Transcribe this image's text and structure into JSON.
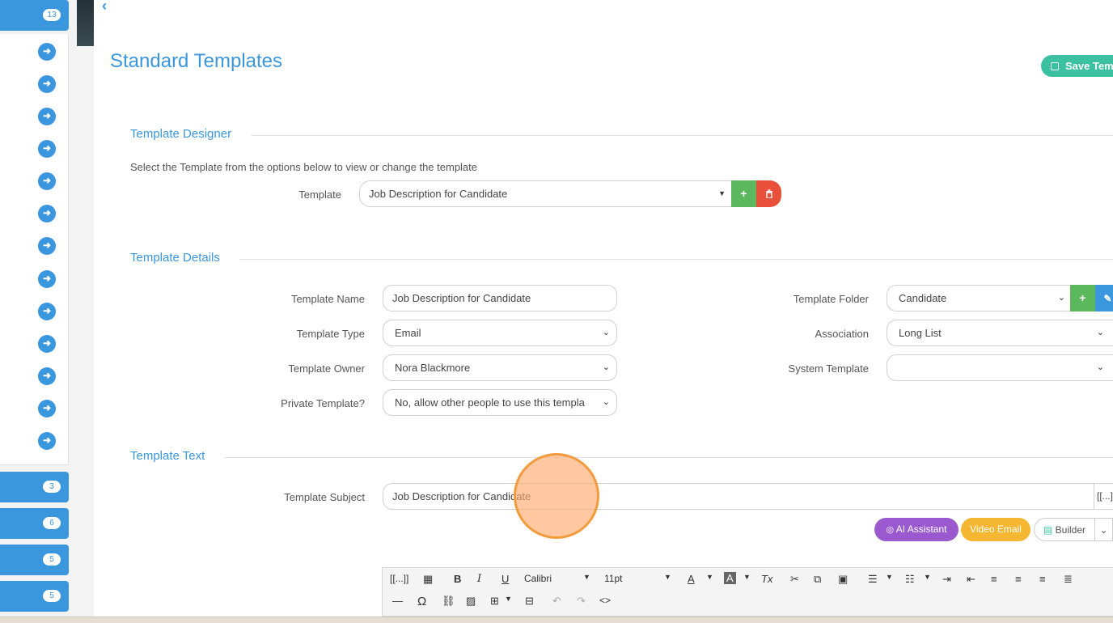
{
  "sidebar": {
    "top_badge": "13",
    "bottom_badges": [
      "3",
      "6",
      "5",
      "5"
    ],
    "arrow_icon": "arrow-right-icon"
  },
  "header": {
    "title": "Standard Templates",
    "save_label": "Save Temp"
  },
  "designer": {
    "section_title": "Template Designer",
    "helper_text": "Select the Template from the options below to view or change the template",
    "template_label": "Template",
    "template_value": "Job Description for Candidate",
    "add_symbol": "+",
    "delete_icon": "trash-icon"
  },
  "details": {
    "section_title": "Template Details",
    "name_label": "Template Name",
    "name_value": "Job Description for Candidate",
    "type_label": "Template Type",
    "type_value": "Email",
    "owner_label": "Template Owner",
    "owner_value": "Nora Blackmore",
    "private_label": "Private Template?",
    "private_value": "No, allow other people to use this templa",
    "folder_label": "Template Folder",
    "folder_value": "Candidate",
    "association_label": "Association",
    "association_value": "Long List",
    "system_label": "System Template",
    "system_value": ""
  },
  "text": {
    "section_title": "Template Text",
    "subject_label": "Template Subject",
    "subject_value": "Job Description for Candidate",
    "merge_field_label": "[[...]]",
    "ai_label": "AI Assistant",
    "video_label": "Video Email",
    "builder_label": "Builder"
  },
  "editor": {
    "merge_label": "[[...]]",
    "bold": "B",
    "italic": "I",
    "underline": "U",
    "font_family": "Calibri",
    "font_size": "11pt",
    "text_color": "A",
    "highlight": "A",
    "clear_format": "Tx",
    "omega": "Ω",
    "source": "<>"
  },
  "colors": {
    "accent": "#3a96dd",
    "save": "#3cc1a0",
    "add": "#5cb85c",
    "delete": "#e8503a",
    "ai": "#9b59d0",
    "video": "#f5b731"
  }
}
